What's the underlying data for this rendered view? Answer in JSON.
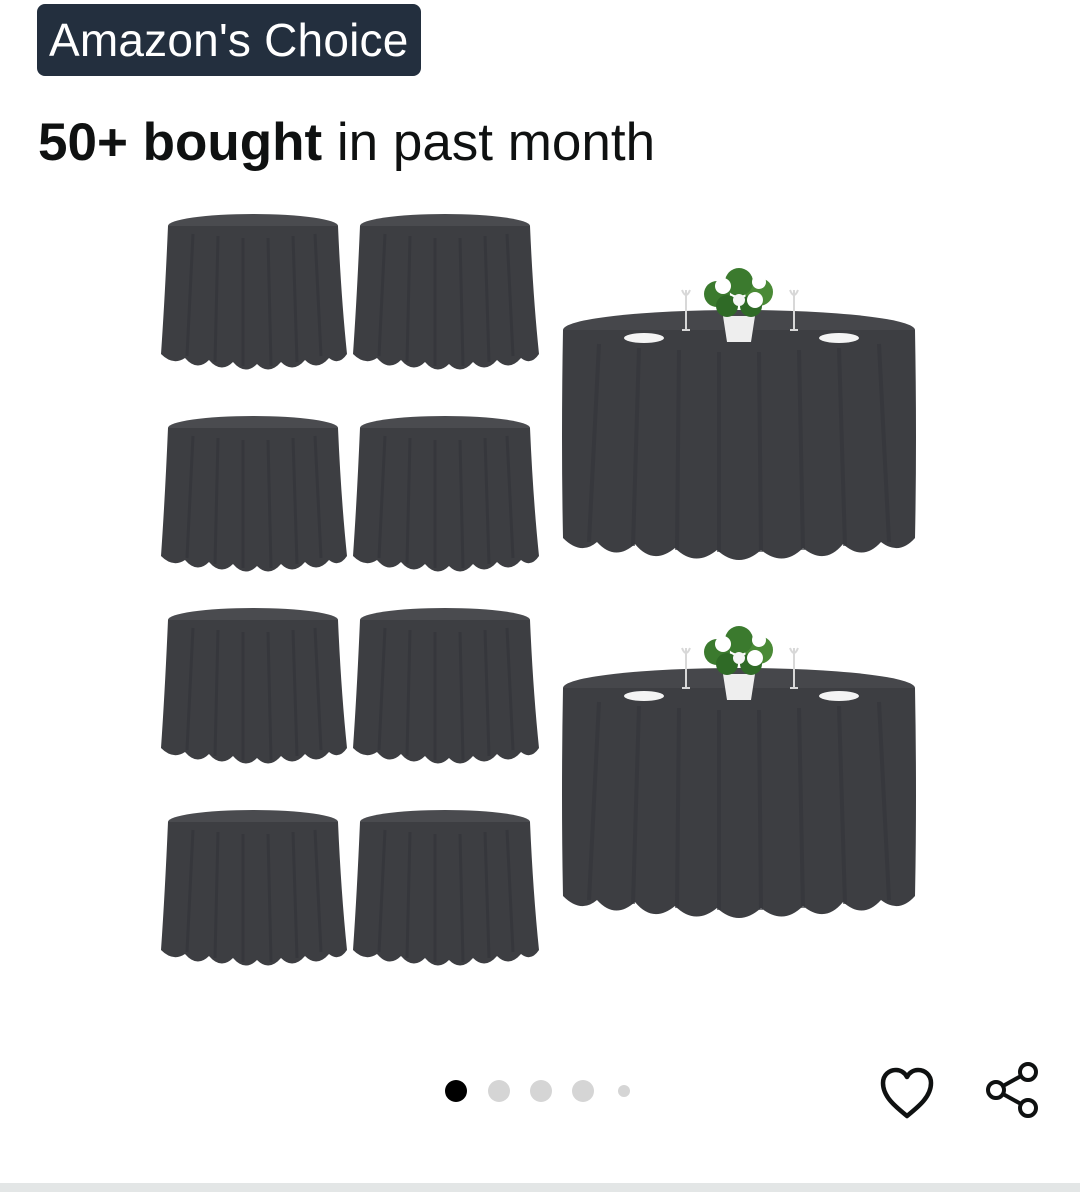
{
  "badge": {
    "label": "Amazon's Choice"
  },
  "social_proof": {
    "count_text": "50+ bought",
    "suffix_text": " in past month"
  },
  "carousel": {
    "total_images": 5,
    "active_index": 0
  },
  "icons": {
    "wishlist": "heart-icon",
    "share": "share-icon"
  },
  "colors": {
    "badge_bg": "#232f3e",
    "cloth": "#3d3e42",
    "dot_active": "#000000",
    "dot_inactive": "#d5d5d5"
  }
}
